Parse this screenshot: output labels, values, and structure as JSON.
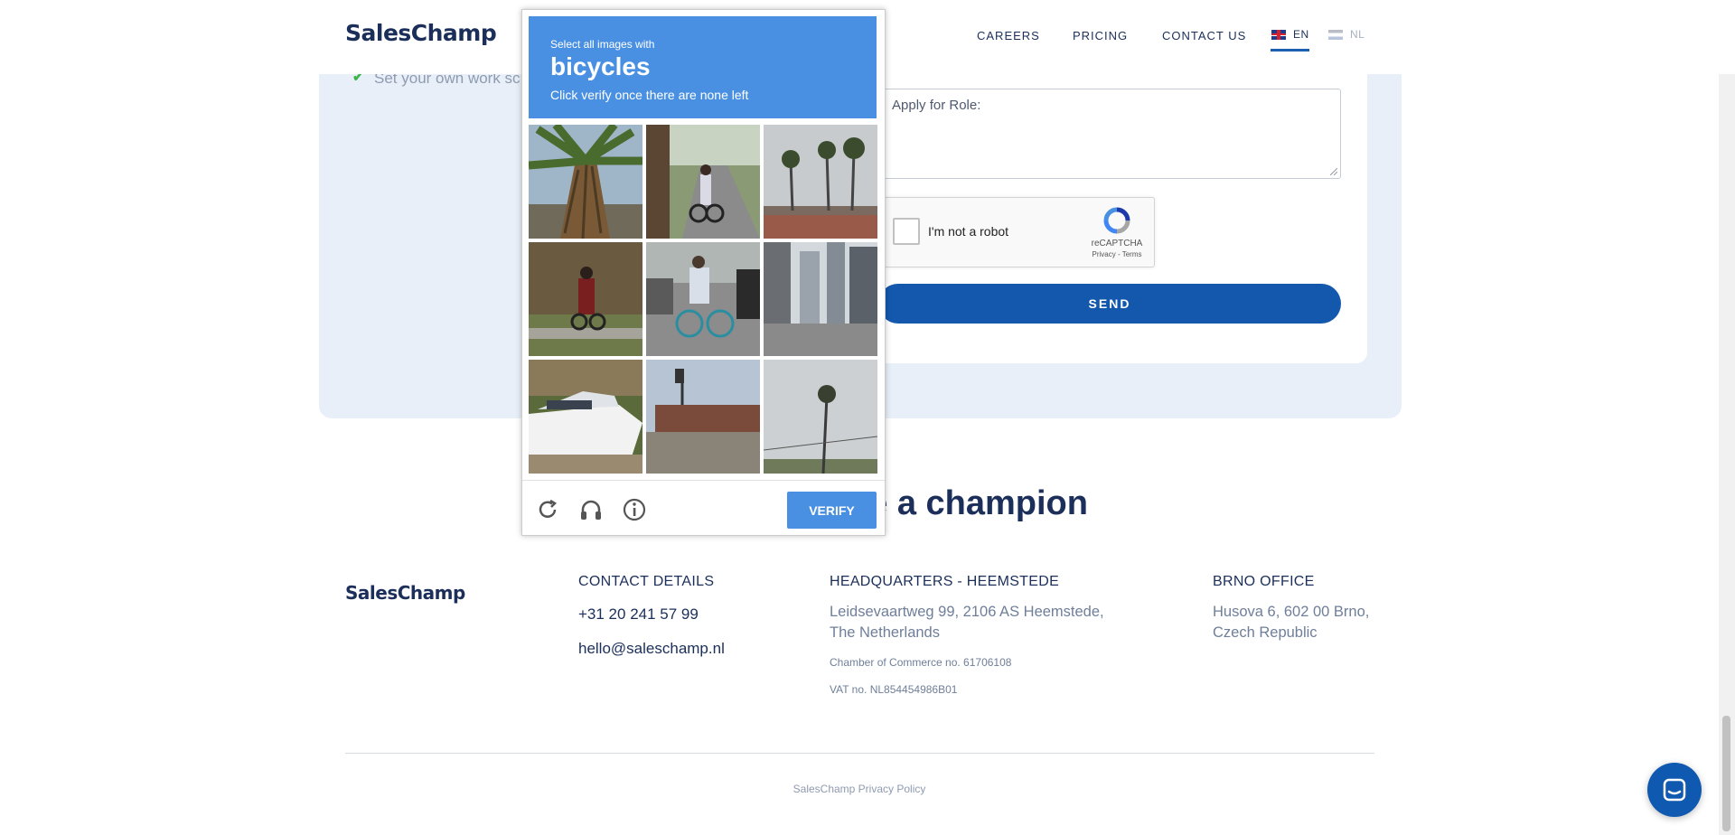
{
  "header": {
    "logo": "SalesChamp",
    "nav": [
      "CAREERS",
      "PRICING",
      "CONTACT US"
    ],
    "languages": [
      {
        "code": "EN",
        "active": true
      },
      {
        "code": "NL",
        "active": false
      }
    ]
  },
  "benefit": "Set your own work sc",
  "form": {
    "role_placeholder": "Apply for Role:",
    "recaptcha_label": "I'm not a robot",
    "recaptcha_brand": "reCAPTCHA",
    "recaptcha_terms": "Privacy - Terms",
    "send_label": "SEND"
  },
  "section_title": "ke a champion",
  "footer": {
    "logo": "SalesChamp",
    "contact": {
      "heading": "CONTACT DETAILS",
      "phone": "+31 20 241 57 99",
      "email": "hello@saleschamp.nl"
    },
    "hq": {
      "heading": "HEADQUARTERS - HEEMSTEDE",
      "address_line1": "Leidsevaartweg 99, 2106 AS Heemstede,",
      "address_line2": "The Netherlands",
      "chamber": "Chamber of Commerce no. 61706108",
      "vat": "VAT no. NL854454986B01"
    },
    "brno": {
      "heading": "BRNO OFFICE",
      "address_line1": "Husova 6, 602 00 Brno,",
      "address_line2": "Czech Republic"
    },
    "policy": "SalesChamp Privacy Policy"
  },
  "captcha": {
    "select_text": "Select all images with",
    "object": "bicycles",
    "instruction": "Click verify once there are none left",
    "verify_label": "VERIFY",
    "tiles": [
      "palm-tree",
      "cyclist-road",
      "palm-trees-street",
      "cyclist-sidewalk",
      "cyclist-street",
      "city-street",
      "boat",
      "street-bridge",
      "palm-tree-sky"
    ],
    "icons": [
      "reload-icon",
      "audio-icon",
      "info-icon"
    ]
  },
  "colors": {
    "brand_navy": "#1b2f5a",
    "accent_blue": "#1458ad",
    "captcha_blue": "#4a90e2",
    "section_bg": "#e8eff8",
    "check_green": "#3cb54a"
  }
}
